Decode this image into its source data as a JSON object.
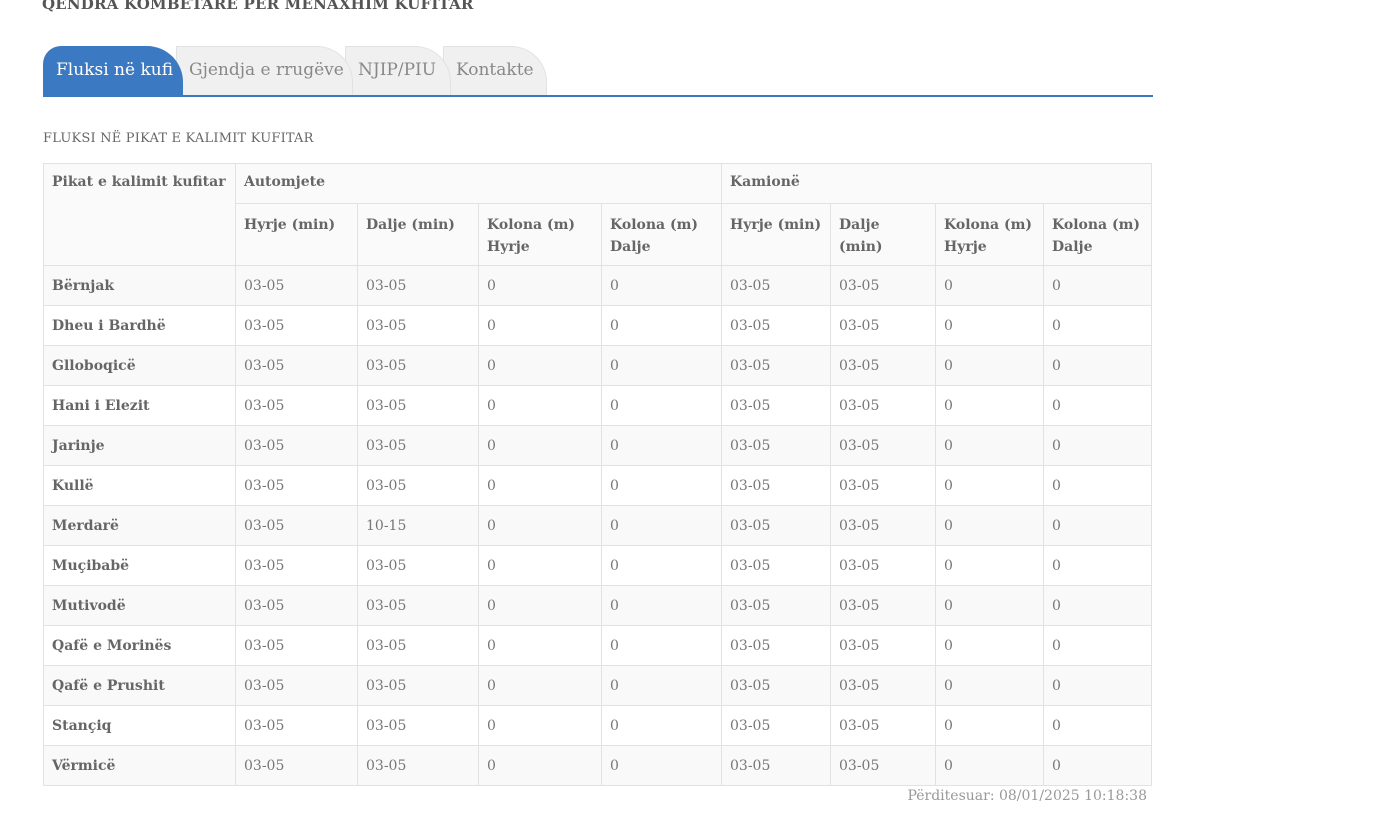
{
  "header": {
    "title": "QENDRA KOMBËTARE PËR MENAXHIM KUFITAR"
  },
  "tabs": [
    {
      "label": "Fluksi në kufi",
      "active": true
    },
    {
      "label": "Gjendja e rrugëve",
      "active": false
    },
    {
      "label": "NJIP/PIU",
      "active": false
    },
    {
      "label": "Kontakte",
      "active": false
    }
  ],
  "section": {
    "title": "FLUKSI NË PIKAT E KALIMIT KUFITAR"
  },
  "table": {
    "corner_header": "Pikat e kalimit kufitar",
    "group_headers": [
      "Automjete",
      "Kamionë"
    ],
    "sub_headers": [
      "Hyrje (min)",
      "Dalje (min)",
      "Kolona (m) Hyrje",
      "Kolona (m) Dalje",
      "Hyrje (min)",
      "Dalje (min)",
      "Kolona (m) Hyrje",
      "Kolona (m) Dalje"
    ],
    "rows": [
      {
        "name": "Bërnjak",
        "values": [
          "03-05",
          "03-05",
          "0",
          "0",
          "03-05",
          "03-05",
          "0",
          "0"
        ]
      },
      {
        "name": "Dheu i Bardhë",
        "values": [
          "03-05",
          "03-05",
          "0",
          "0",
          "03-05",
          "03-05",
          "0",
          "0"
        ]
      },
      {
        "name": "Glloboqicë",
        "values": [
          "03-05",
          "03-05",
          "0",
          "0",
          "03-05",
          "03-05",
          "0",
          "0"
        ]
      },
      {
        "name": "Hani i Elezit",
        "values": [
          "03-05",
          "03-05",
          "0",
          "0",
          "03-05",
          "03-05",
          "0",
          "0"
        ]
      },
      {
        "name": "Jarinje",
        "values": [
          "03-05",
          "03-05",
          "0",
          "0",
          "03-05",
          "03-05",
          "0",
          "0"
        ]
      },
      {
        "name": "Kullë",
        "values": [
          "03-05",
          "03-05",
          "0",
          "0",
          "03-05",
          "03-05",
          "0",
          "0"
        ]
      },
      {
        "name": "Merdarë",
        "values": [
          "03-05",
          "10-15",
          "0",
          "0",
          "03-05",
          "03-05",
          "0",
          "0"
        ]
      },
      {
        "name": "Muçibabë",
        "values": [
          "03-05",
          "03-05",
          "0",
          "0",
          "03-05",
          "03-05",
          "0",
          "0"
        ]
      },
      {
        "name": "Mutivodë",
        "values": [
          "03-05",
          "03-05",
          "0",
          "0",
          "03-05",
          "03-05",
          "0",
          "0"
        ]
      },
      {
        "name": "Qafë e Morinës",
        "values": [
          "03-05",
          "03-05",
          "0",
          "0",
          "03-05",
          "03-05",
          "0",
          "0"
        ]
      },
      {
        "name": "Qafë e Prushit",
        "values": [
          "03-05",
          "03-05",
          "0",
          "0",
          "03-05",
          "03-05",
          "0",
          "0"
        ]
      },
      {
        "name": "Stançiq",
        "values": [
          "03-05",
          "03-05",
          "0",
          "0",
          "03-05",
          "03-05",
          "0",
          "0"
        ]
      },
      {
        "name": "Vërmicë",
        "values": [
          "03-05",
          "03-05",
          "0",
          "0",
          "03-05",
          "03-05",
          "0",
          "0"
        ]
      }
    ]
  },
  "footer": {
    "updated": "Përditesuar: 08/01/2025 10:18:38"
  },
  "colors": {
    "accent": "#3b7ac2",
    "tab_inactive": "#f0f0f0",
    "border": "#e2e2e2"
  }
}
